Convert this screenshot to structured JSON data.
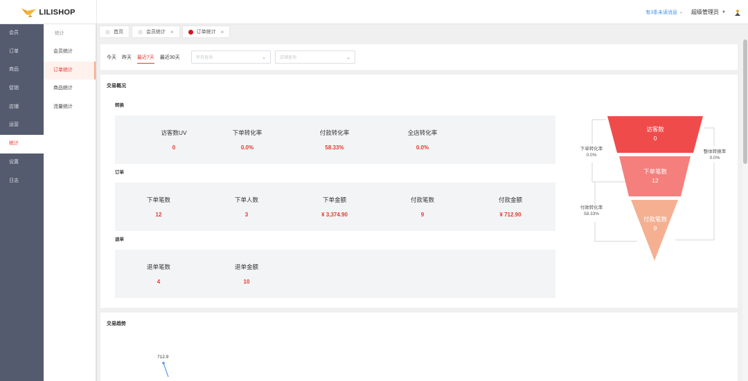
{
  "app": {
    "logo_text": "LILISHOP"
  },
  "topbar": {
    "messages": "有3条未读消息",
    "user": "超级管理员"
  },
  "sidebar": {
    "items": [
      {
        "label": "会员"
      },
      {
        "label": "订单"
      },
      {
        "label": "商品"
      },
      {
        "label": "促销"
      },
      {
        "label": "店铺"
      },
      {
        "label": "运营"
      },
      {
        "label": "统计"
      },
      {
        "label": "设置"
      },
      {
        "label": "日志"
      }
    ]
  },
  "submenu": {
    "title": "统计",
    "items": [
      {
        "label": "会员统计"
      },
      {
        "label": "订单统计"
      },
      {
        "label": "商品统计"
      },
      {
        "label": "流量统计"
      }
    ]
  },
  "tabs": [
    {
      "label": "首页"
    },
    {
      "label": "会员统计"
    },
    {
      "label": "订单统计"
    }
  ],
  "filter": {
    "quick": [
      "今天",
      "昨天",
      "最近7天",
      "最近30天"
    ],
    "year_month_placeholder": "年月查询",
    "shop_placeholder": "店铺查询"
  },
  "overview": {
    "title": "交易概况",
    "conversion_title": "转换",
    "conversion": [
      {
        "label": "访客数UV",
        "value": "0"
      },
      {
        "label": "下单转化率",
        "value": "0.0%"
      },
      {
        "label": "付款转化率",
        "value": "58.33%"
      },
      {
        "label": "全店转化率",
        "value": "0.0%"
      }
    ],
    "order_title": "订单",
    "order": [
      {
        "label": "下单笔数",
        "value": "12"
      },
      {
        "label": "下单人数",
        "value": "3"
      },
      {
        "label": "下单金额",
        "value": "¥ 3,374.90"
      },
      {
        "label": "付款笔数",
        "value": "9"
      },
      {
        "label": "付款金额",
        "value": "¥ 712.90"
      }
    ],
    "refund_title": "退单",
    "refund": [
      {
        "label": "退单笔数",
        "value": "4"
      },
      {
        "label": "退单金额",
        "value": "10"
      }
    ]
  },
  "funnel": {
    "visitors_label": "访客数",
    "visitors_value": "0",
    "orders_label": "下单笔数",
    "orders_value": "12",
    "paid_label": "付款笔数",
    "paid_value": "9",
    "order_rate_label": "下单转化率",
    "order_rate_value": "0.0%",
    "pay_rate_label": "付款转化率",
    "pay_rate_value": "58.33%",
    "overall_label": "整体转换率",
    "overall_value": "0.0%",
    "colors": {
      "top": "#f04b4b",
      "middle": "#f47f7c",
      "bottom": "#f5b092"
    }
  },
  "trend": {
    "title": "交易趋势",
    "peak_label": "712.9"
  },
  "colors": {
    "accent": "#e5382f",
    "sidebar_bg": "#545b6e",
    "link": "#3f8fe8"
  }
}
